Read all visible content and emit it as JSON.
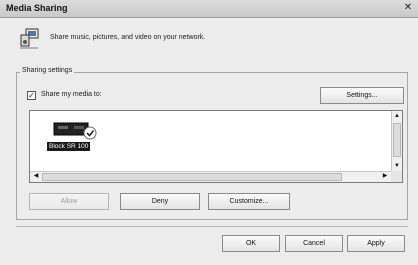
{
  "window": {
    "title": "Media Sharing"
  },
  "header": {
    "text": "Share music, pictures, and video on your network."
  },
  "sharing_settings": {
    "group_label": "Sharing settings",
    "share_checkbox_label": "Share my media to:",
    "share_checked": true,
    "settings_button": "Settings..."
  },
  "device_list": {
    "items": [
      {
        "label": "Block SR 100",
        "status": "allowed"
      }
    ]
  },
  "device_actions": {
    "allow": "Allow",
    "deny": "Deny",
    "customize": "Customize..."
  },
  "footer": {
    "ok": "OK",
    "cancel": "Cancel",
    "apply": "Apply"
  }
}
